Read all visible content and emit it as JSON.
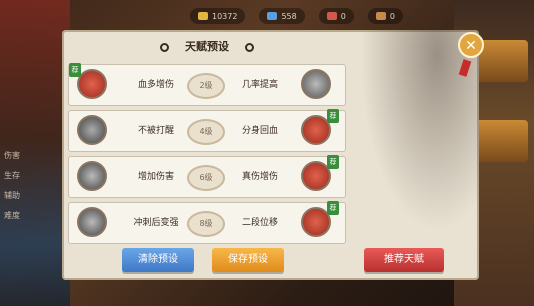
{
  "top_resources": [
    "10372",
    "558",
    "0",
    "0"
  ],
  "panel": {
    "title": "天赋预设",
    "rows": [
      {
        "left_label": "血多增伤",
        "level": "2级",
        "right_label": "几率提高",
        "left_selected": true,
        "right_selected": false
      },
      {
        "left_label": "不被打醒",
        "level": "4级",
        "right_label": "分身回血",
        "left_selected": false,
        "right_selected": true
      },
      {
        "left_label": "增加伤害",
        "level": "6级",
        "right_label": "真伤增伤",
        "left_selected": false,
        "right_selected": true
      },
      {
        "left_label": "冲刺后变强",
        "level": "8级",
        "right_label": "二段位移",
        "left_selected": false,
        "right_selected": true
      }
    ],
    "selected_marker": "荐",
    "buttons": {
      "clear": "清除预设",
      "save": "保存预设",
      "recommend": "推荐天赋"
    }
  },
  "sidebar_left": {
    "stats": [
      "伤害",
      "生存",
      "辅助",
      "难度"
    ]
  },
  "icons": {
    "close": "close-icon",
    "row_icons": [
      "talent-red-icon",
      "talent-gray-icon"
    ]
  },
  "colors": {
    "clear_button": "#4a8ad6",
    "save_button": "#f0a030",
    "recommend_button": "#d04442"
  }
}
